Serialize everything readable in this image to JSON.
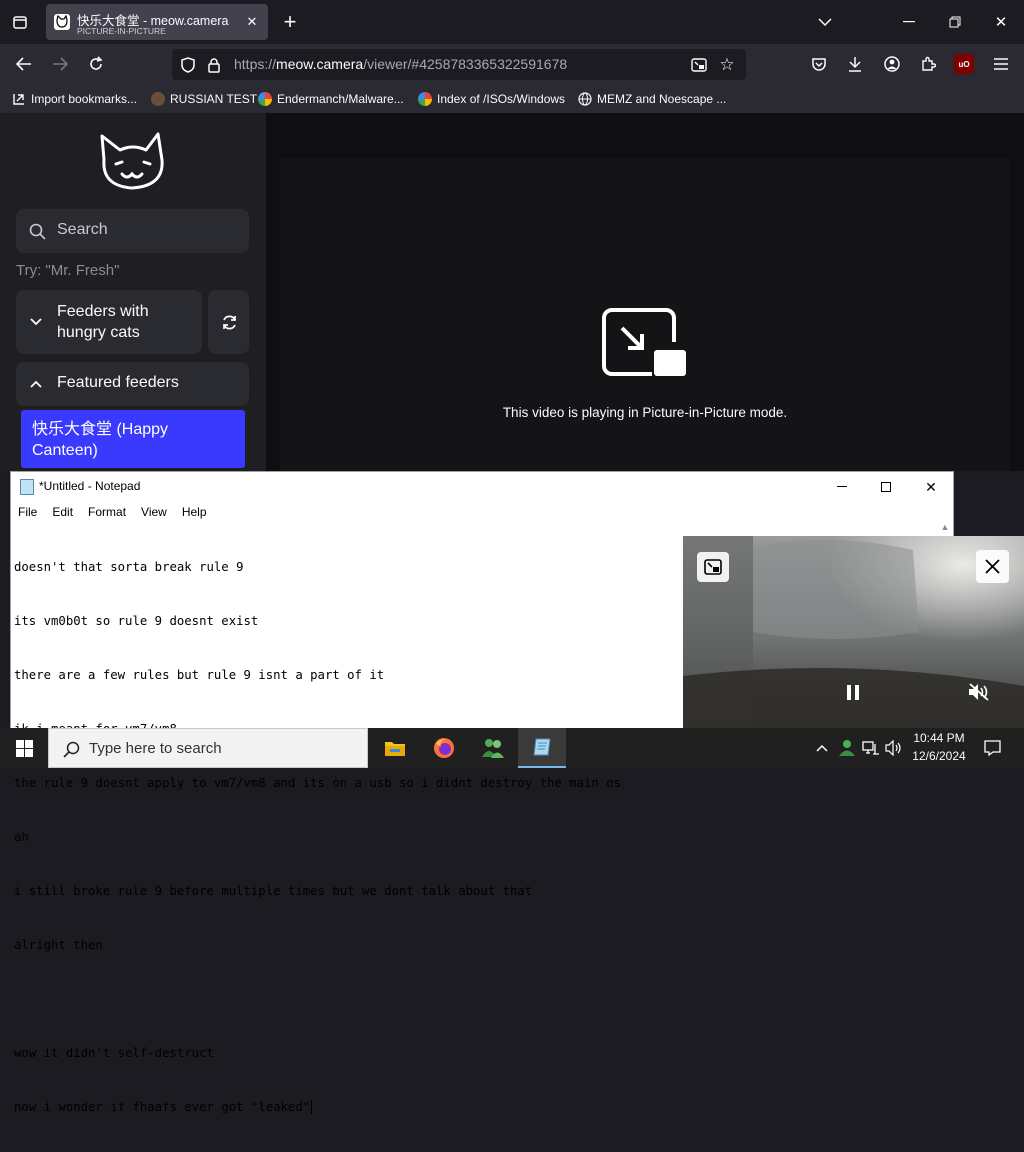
{
  "browser": {
    "tab": {
      "title": "快乐大食堂 - meow.camera",
      "subtitle": "PICTURE-IN-PICTURE"
    },
    "new_tab_symbol": "+",
    "url": {
      "scheme": "https://",
      "host": "meow.camera",
      "path": "/viewer/#4258783365322591678"
    },
    "bookmarks": [
      {
        "label": "Import bookmarks...",
        "icon": "import-icon"
      },
      {
        "label": "RUSSIAN TEST",
        "icon": "ram-icon"
      },
      {
        "label": "Endermanch/Malware...",
        "icon": "google-icon"
      },
      {
        "label": "Index of /ISOs/Windows",
        "icon": "google-icon"
      },
      {
        "label": "MEMZ and Noescape ...",
        "icon": "globe-icon"
      }
    ],
    "ublock_label": "uO"
  },
  "site": {
    "search_placeholder": "Search",
    "try_hint": "Try: \"Mr. Fresh\"",
    "section_hungry": "Feeders with hungry cats",
    "section_featured": "Featured feeders",
    "featured_item": "快乐大食堂 (Happy Canteen)",
    "pip_message": "This video is playing in Picture-in-Picture mode."
  },
  "notepad": {
    "title": "*Untitled - Notepad",
    "menu": [
      "File",
      "Edit",
      "Format",
      "View",
      "Help"
    ],
    "lines": [
      "doesn't that sorta break rule 9",
      "its vm0b0t so rule 9 doesnt exist",
      "there are a few rules but rule 9 isnt a part of it",
      "ik i meant for vm7/vm8",
      "the rule 9 doesnt apply to vm7/vm8 and its on a usb so i didnt destroy the main os",
      "ah",
      "i still broke rule 9 before multiple times but we dont talk about that",
      "alright then",
      "",
      "wow it didn't self-destruct",
      "now i wonder if fhaafs ever got \"leaked\""
    ]
  },
  "taskbar": {
    "search_placeholder": "Type here to search",
    "time": "10:44 PM",
    "date": "12/6/2024"
  },
  "colors": {
    "accent_featured": "#3a3aff",
    "taskbar": "#202020"
  }
}
